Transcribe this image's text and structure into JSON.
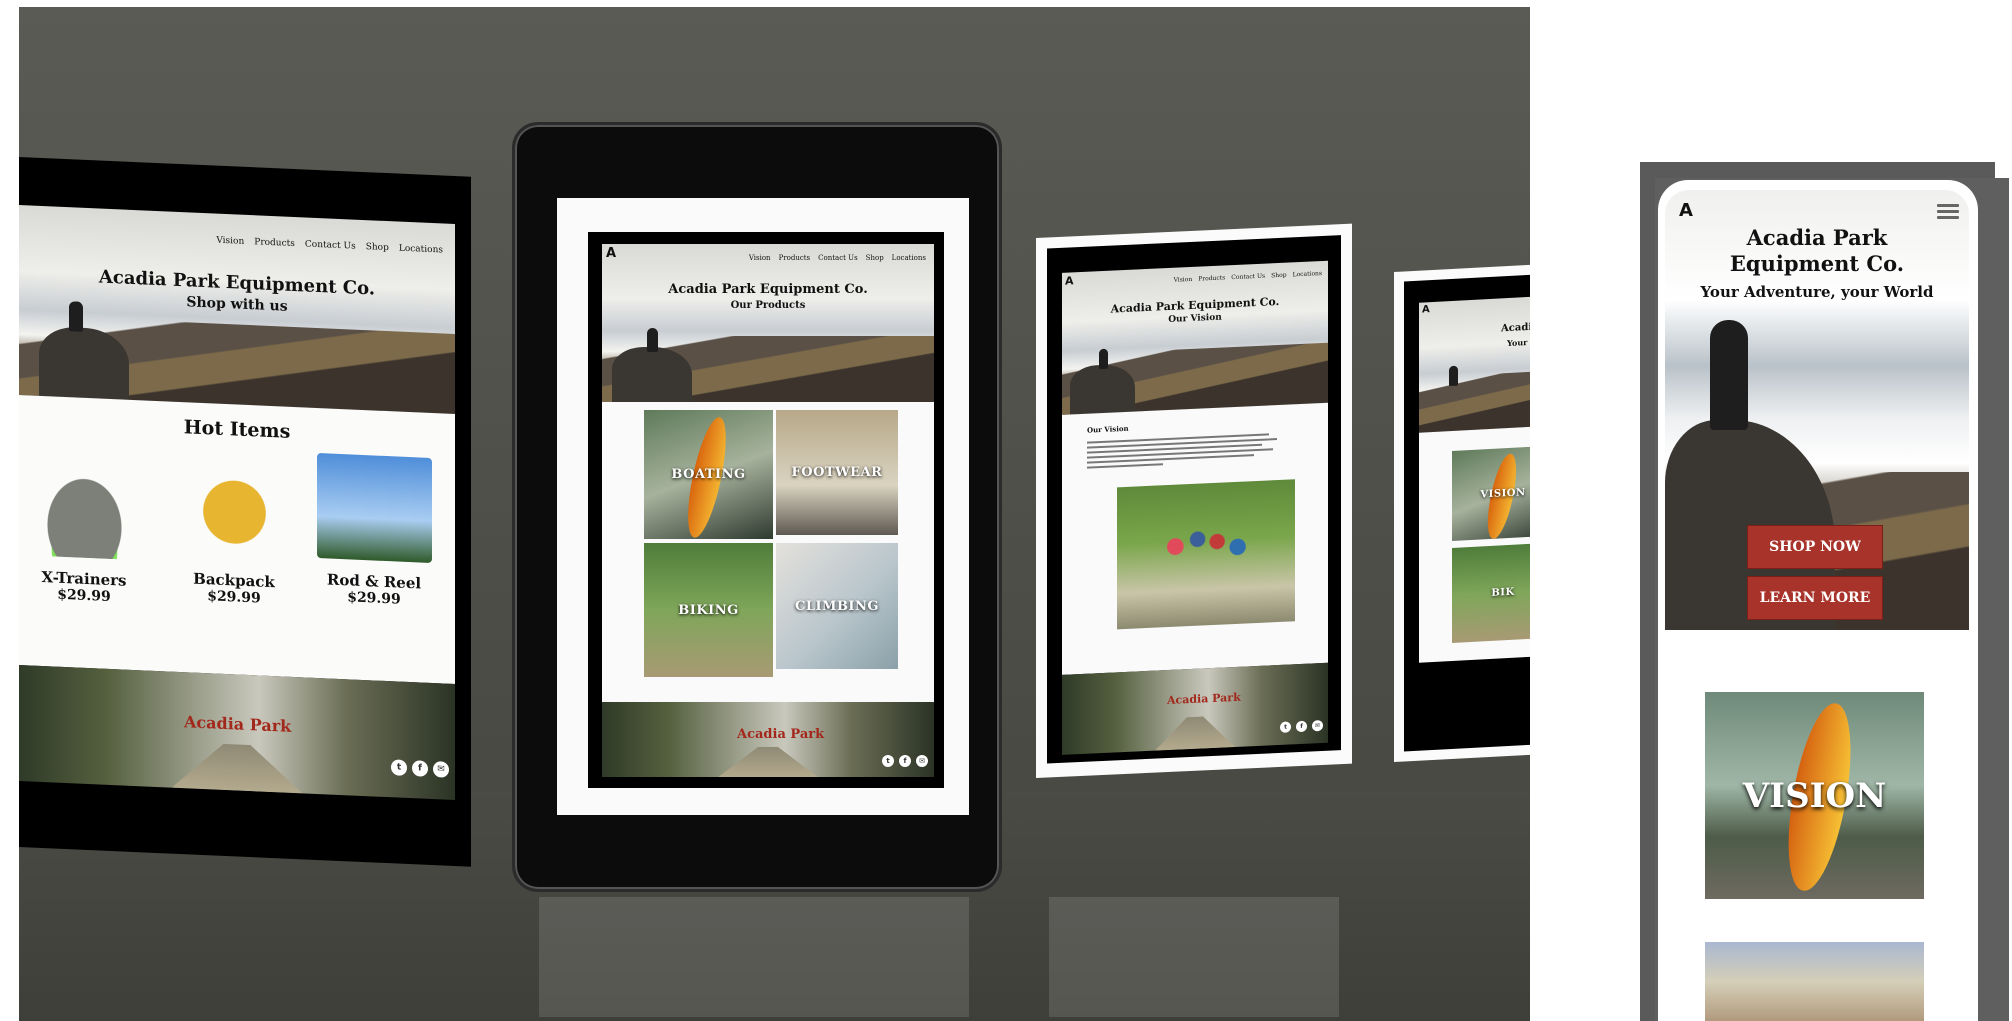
{
  "brand": {
    "name": "Acadia Park Equipment Co.",
    "phone_name_line1": "Acadia Park",
    "phone_name_line2": "Equipment Co.",
    "logo_glyph": "A",
    "footer_logo": "Acadia Park",
    "accent_color": "#a8332a"
  },
  "nav": [
    "Vision",
    "Products",
    "Contact Us",
    "Shop",
    "Locations"
  ],
  "screen_home": {
    "subtitle": "Shop with us",
    "section_title": "Hot Items",
    "products": [
      {
        "name": "X-Trainers",
        "price": "$29.99",
        "icon": "shoe-icon"
      },
      {
        "name": "Backpack",
        "price": "$29.99",
        "icon": "backpack-icon"
      },
      {
        "name": "Rod & Reel",
        "price": "$29.99",
        "icon": "reel-icon"
      }
    ]
  },
  "screen_products": {
    "subtitle": "Our Products",
    "tiles": [
      "BOATING",
      "FOOTWEAR",
      "BIKING",
      "CLIMBING"
    ]
  },
  "screen_vision": {
    "subtitle": "Our Vision",
    "section_title": "Our Vision"
  },
  "screen_partial": {
    "title_fragment": "Acadia P",
    "subtitle_fragment": "Your A",
    "tile_label": "VISION",
    "tile_label_2": "BIK"
  },
  "social_icons": [
    "twitter-icon",
    "facebook-icon",
    "mail-icon"
  ],
  "social_glyphs": [
    "t",
    "f",
    "✉"
  ],
  "phone": {
    "tagline": "Your Adventure, your World",
    "shop_button": "SHOP NOW",
    "learn_button": "LEARN MORE",
    "card_label": "VISION",
    "menu_icon": "hamburger-menu-icon"
  }
}
